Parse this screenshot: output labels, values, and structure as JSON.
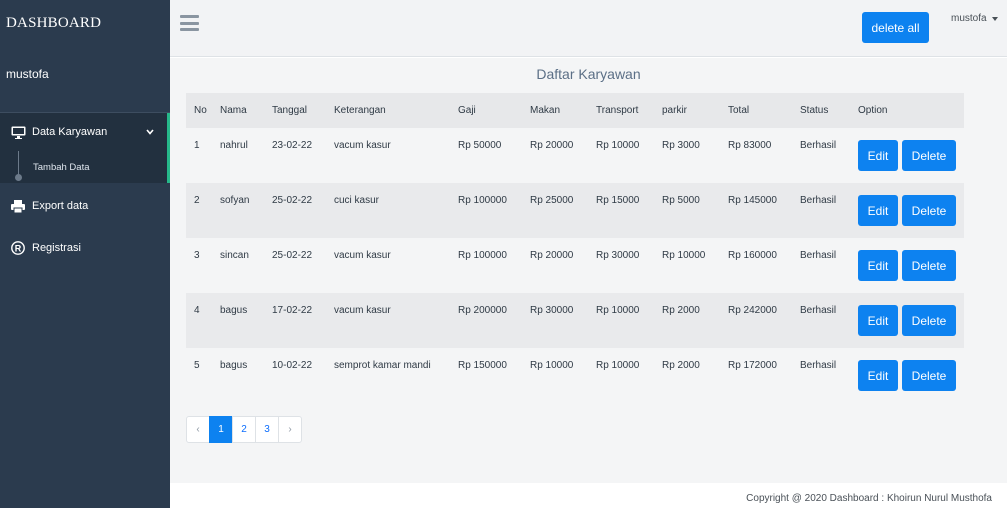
{
  "sidebar": {
    "brand": "DASHBOARD",
    "user": "mustofa",
    "menu": [
      {
        "label": "Data Karyawan",
        "icon": "monitor-icon"
      },
      {
        "label": "Export data",
        "icon": "printer-icon"
      },
      {
        "label": "Registrasi",
        "icon": "registered-icon"
      }
    ],
    "submenu": {
      "label": "Tambah Data"
    }
  },
  "topbar": {
    "delete_all_label": "delete all",
    "user": "mustofa"
  },
  "main": {
    "title": "Daftar Karyawan",
    "columns": [
      "No",
      "Nama",
      "Tanggal",
      "Keterangan",
      "Gaji",
      "Makan",
      "Transport",
      "parkir",
      "Total",
      "Status",
      "Option"
    ],
    "rows": [
      {
        "no": "1",
        "nama": "nahrul",
        "tanggal": "23-02-22",
        "keterangan": "vacum kasur",
        "gaji": "Rp 50000",
        "makan": "Rp 20000",
        "transport": "Rp 10000",
        "parkir": "Rp 3000",
        "total": "Rp 83000",
        "status": "Berhasil"
      },
      {
        "no": "2",
        "nama": "sofyan",
        "tanggal": "25-02-22",
        "keterangan": "cuci kasur",
        "gaji": "Rp 100000",
        "makan": "Rp 25000",
        "transport": "Rp 15000",
        "parkir": "Rp 5000",
        "total": "Rp 145000",
        "status": "Berhasil"
      },
      {
        "no": "3",
        "nama": "sincan",
        "tanggal": "25-02-22",
        "keterangan": "vacum kasur",
        "gaji": "Rp 100000",
        "makan": "Rp 20000",
        "transport": "Rp 30000",
        "parkir": "Rp 10000",
        "total": "Rp 160000",
        "status": "Berhasil"
      },
      {
        "no": "4",
        "nama": "bagus",
        "tanggal": "17-02-22",
        "keterangan": "vacum kasur",
        "gaji": "Rp 200000",
        "makan": "Rp 30000",
        "transport": "Rp 10000",
        "parkir": "Rp 2000",
        "total": "Rp 242000",
        "status": "Berhasil"
      },
      {
        "no": "5",
        "nama": "bagus",
        "tanggal": "10-02-22",
        "keterangan": "semprot kamar mandi",
        "gaji": "Rp 150000",
        "makan": "Rp 10000",
        "transport": "Rp 10000",
        "parkir": "Rp 2000",
        "total": "Rp 172000",
        "status": "Berhasil"
      }
    ],
    "edit_label": "Edit",
    "delete_label": "Delete"
  },
  "pagination": {
    "prev": "‹",
    "pages": [
      "1",
      "2",
      "3"
    ],
    "next": "›",
    "active": "1"
  },
  "footer": {
    "text": "Copyright @ 2020 Dashboard : Khoirun Nurul Musthofa"
  },
  "colors": {
    "sidebar_bg": "#2b3b4e",
    "accent": "#0d82f0",
    "active_indicator": "#26b88a"
  }
}
